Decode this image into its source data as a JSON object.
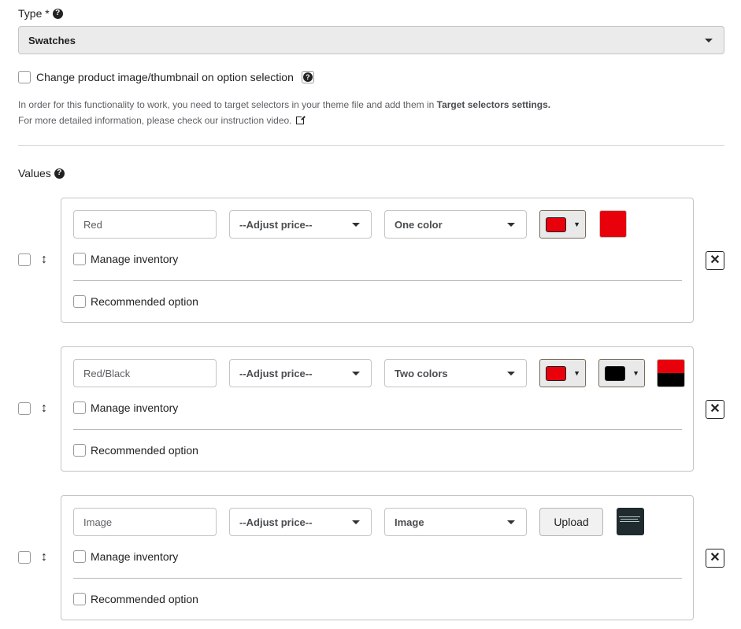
{
  "type_field": {
    "label": "Type *",
    "selected": "Swatches"
  },
  "change_image": {
    "label": "Change product image/thumbnail on option selection"
  },
  "info": {
    "line1_prefix": "In order for this functionality to work, you need to target selectors in your theme file and add them in ",
    "line1_bold": "Target selectors settings.",
    "line2": "For more detailed information, please check our instruction video."
  },
  "values_label": "Values",
  "rows": [
    {
      "name_value": "Red",
      "price_select": "--Adjust price--",
      "kind_select": "One color",
      "colors": [
        "#e8000b"
      ],
      "manage_inventory": "Manage inventory",
      "recommended": "Recommended option"
    },
    {
      "name_value": "Red/Black",
      "price_select": "--Adjust price--",
      "kind_select": "Two colors",
      "colors": [
        "#e8000b",
        "#000000"
      ],
      "manage_inventory": "Manage inventory",
      "recommended": "Recommended option"
    },
    {
      "name_value": "Image",
      "price_select": "--Adjust price--",
      "kind_select": "Image",
      "upload_label": "Upload",
      "manage_inventory": "Manage inventory",
      "recommended": "Recommended option"
    }
  ],
  "icons": {
    "help": "question-circle-icon",
    "external": "external-link-icon",
    "drag": "drag-vertical-icon",
    "delete": "close-box-icon",
    "caret": "chevron-down-icon"
  }
}
